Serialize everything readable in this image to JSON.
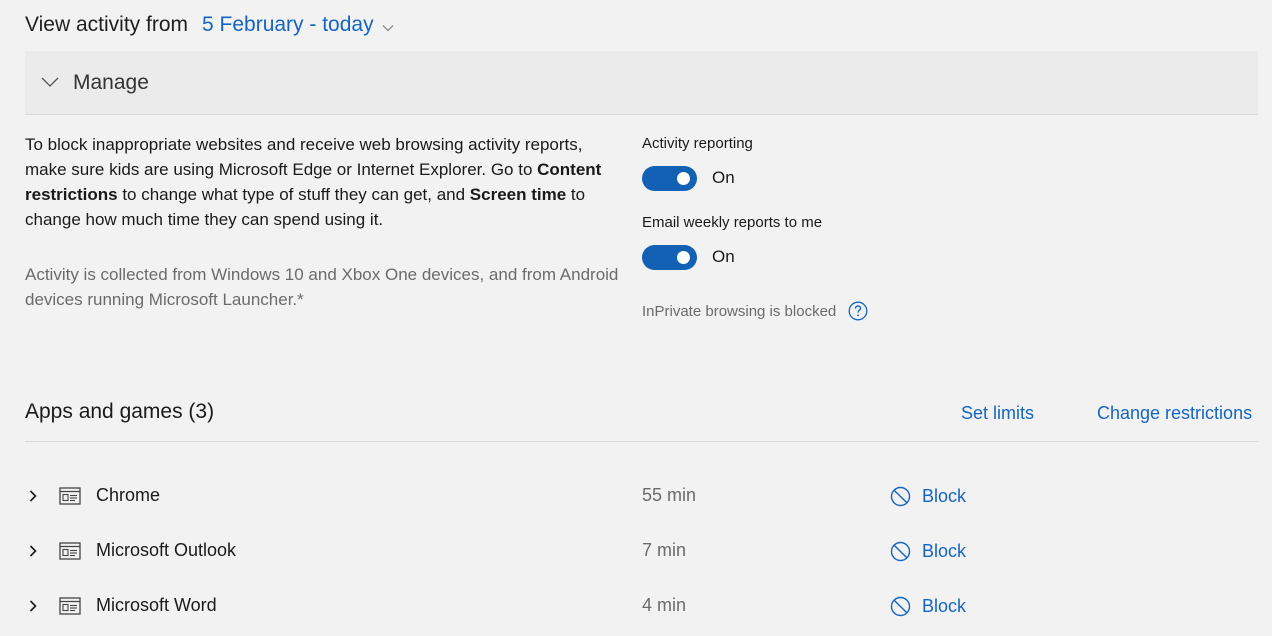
{
  "header": {
    "label": "View activity from",
    "date_range": "5 February - today"
  },
  "manage": {
    "title": "Manage",
    "description": {
      "part1": "To block inappropriate websites and receive web browsing activity reports, make sure kids are using Microsoft Edge or Internet Explorer. Go to ",
      "content_restrictions": "Content restrictions",
      "part2": " to change what type of stuff they can get, and ",
      "screen_time": "Screen time",
      "part3": " to change how much time they can spend using it."
    },
    "note": "Activity is collected from Windows 10 and Xbox One devices, and from Android devices running Microsoft Launcher.*",
    "activity_reporting": {
      "label": "Activity reporting",
      "state": "On"
    },
    "email_reports": {
      "label": "Email weekly reports to me",
      "state": "On"
    },
    "inprivate": "InPrivate browsing is blocked"
  },
  "apps": {
    "title": "Apps and games (3)",
    "set_limits": "Set limits",
    "change_restrictions": "Change restrictions",
    "block_label": "Block",
    "items": [
      {
        "name": "Chrome",
        "time": "55 min"
      },
      {
        "name": "Microsoft Outlook",
        "time": "7 min"
      },
      {
        "name": "Microsoft Word",
        "time": "4 min"
      }
    ]
  },
  "colors": {
    "accent": "#1565c0",
    "toggle": "#1261b5",
    "background": "#f2f2f2"
  }
}
